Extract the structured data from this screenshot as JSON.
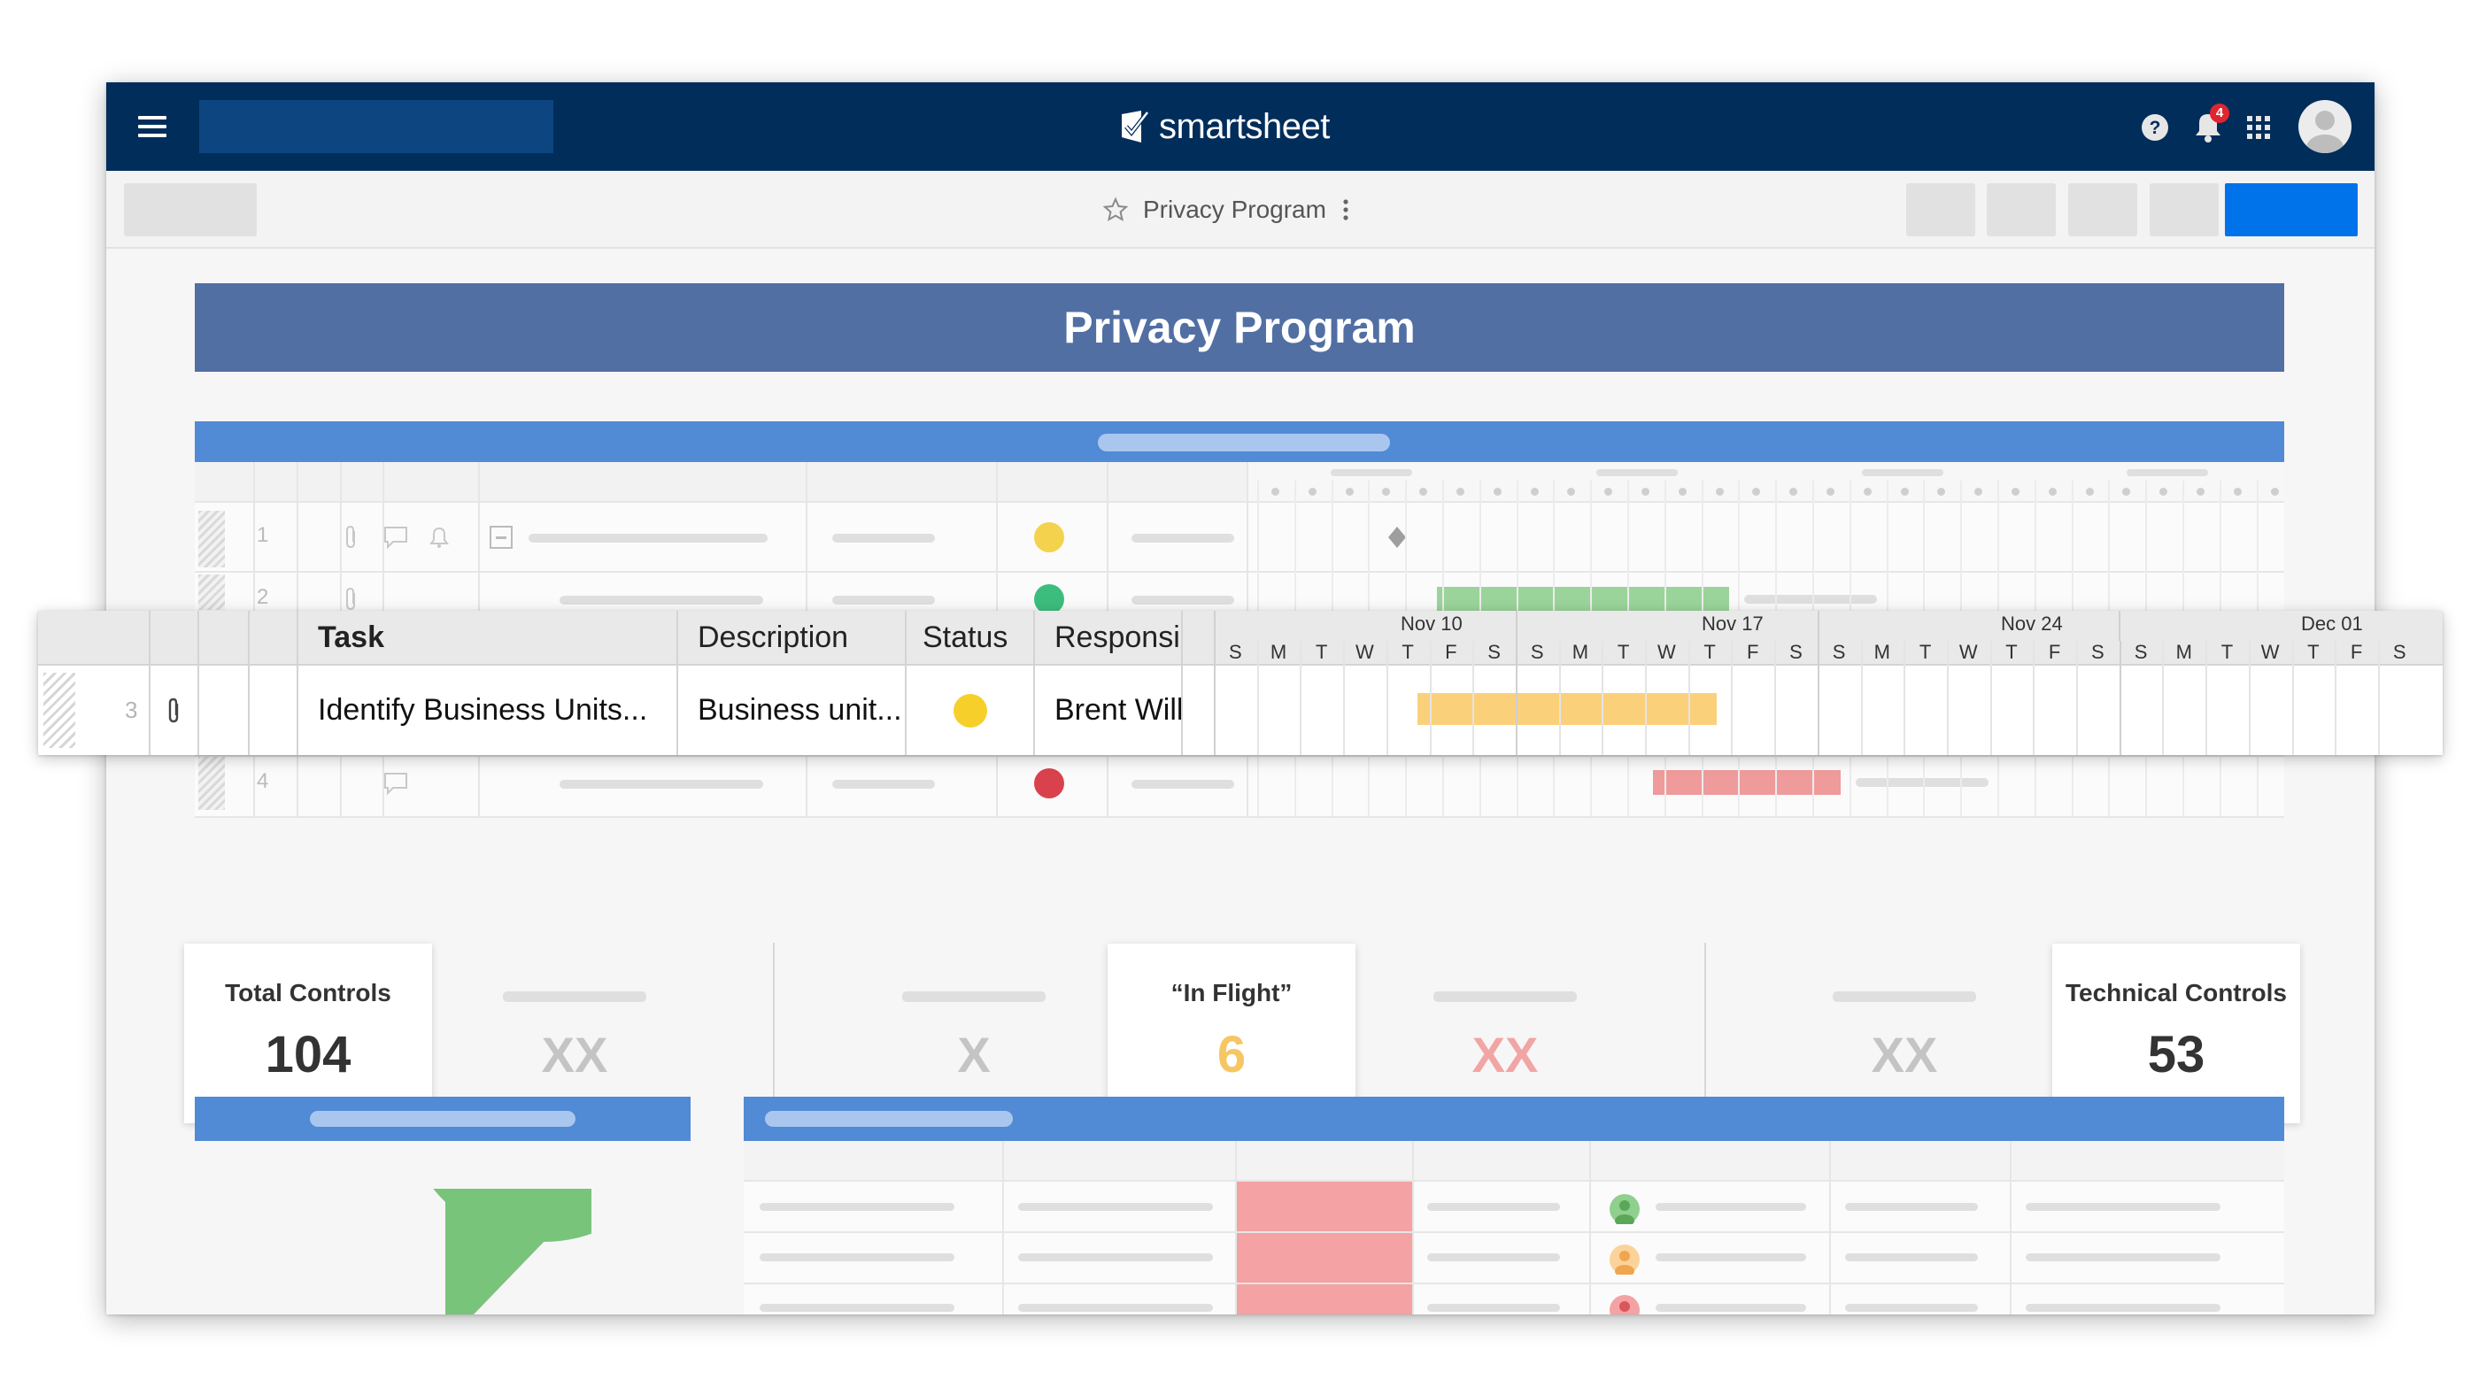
{
  "app": {
    "logo_text": "smartsheet",
    "notification_count": "4",
    "sheet_name": "Privacy Program"
  },
  "dashboard": {
    "title": "Privacy Program"
  },
  "grid": {
    "columns": [
      "Task",
      "Description",
      "Status",
      "Responsi"
    ],
    "row": {
      "number": "3",
      "task": "Identify Business Units...",
      "description": "Business unit...",
      "status_color": "#f6cf2a",
      "responsible": "Brent Will"
    },
    "background_rows": [
      {
        "number": "1",
        "status_color": "#f4d24e"
      },
      {
        "number": "2",
        "status_color": "#3cbd7d"
      },
      {
        "number": "4",
        "status_color": "#d9424d"
      }
    ],
    "weeks": [
      "Nov 10",
      "Nov 17",
      "Nov 24",
      "Dec 01"
    ],
    "days": [
      "S",
      "M",
      "T",
      "W",
      "T",
      "F",
      "S",
      "S",
      "M",
      "T",
      "W",
      "T",
      "F",
      "S",
      "S",
      "M",
      "T",
      "W",
      "T",
      "F",
      "S",
      "S",
      "M",
      "T",
      "W",
      "T",
      "F",
      "S"
    ],
    "bar_colors": {
      "in_progress": "#fbd07a",
      "complete": "#9bd49b",
      "at_risk": "#ef9b9b"
    }
  },
  "metrics": [
    {
      "label": "Total Controls",
      "value": "104",
      "color": "#333333"
    },
    {
      "label": "“In Flight”",
      "value": "6",
      "color": "#f6c663"
    },
    {
      "label": "Technical Controls",
      "value": "53",
      "color": "#333333"
    }
  ],
  "placeholder_values": [
    {
      "value": "XX",
      "color": "#c4c4c4"
    },
    {
      "value": "X",
      "color": "#c4c4c4"
    },
    {
      "value": "XX",
      "color": "#f1a5a5"
    },
    {
      "value": "XX",
      "color": "#c4c4c4"
    }
  ],
  "pie": {
    "colors": [
      "#78c47b",
      "#ef6f6c"
    ]
  }
}
